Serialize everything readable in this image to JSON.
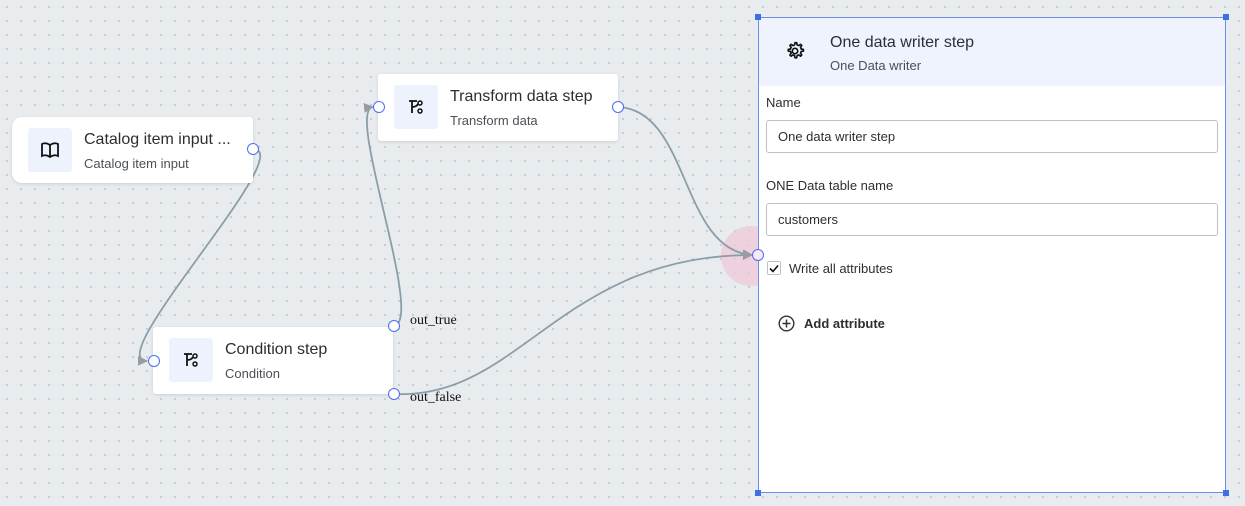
{
  "nodes": {
    "catalog": {
      "title": "Catalog item input ...",
      "subtitle": "Catalog item input",
      "icon": "book-open-icon"
    },
    "transform": {
      "title": "Transform data step",
      "subtitle": "Transform data",
      "icon": "branch-icon"
    },
    "condition": {
      "title": "Condition step",
      "subtitle": "Condition",
      "icon": "branch-icon",
      "ports": {
        "out_true": "out_true",
        "out_false": "out_false"
      }
    }
  },
  "panel": {
    "title": "One data writer step",
    "subtitle": "One Data writer",
    "icon": "gear-icon",
    "name_label": "Name",
    "name_value": "One data writer step",
    "table_label": "ONE Data table name",
    "table_value": "customers",
    "write_all_label": "Write all attributes",
    "write_all_checked": true,
    "add_attribute_label": "Add attribute"
  },
  "colors": {
    "accent": "#4a6cf7",
    "edge": "#8a9ea9",
    "selection": "#6d8fe8",
    "icon_bg": "#eef2fd"
  }
}
